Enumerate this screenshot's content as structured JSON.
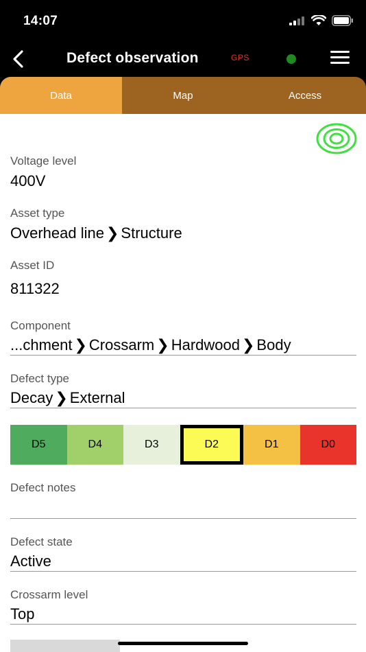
{
  "status_bar": {
    "time": "14:07"
  },
  "nav": {
    "title": "Defect observation",
    "gps_label": "GPS",
    "gps_status_color": "#1f8a1f"
  },
  "tabs": [
    {
      "label": "Data",
      "active": true
    },
    {
      "label": "Map",
      "active": false
    },
    {
      "label": "Access",
      "active": false
    }
  ],
  "fields": {
    "voltage_level": {
      "label": "Voltage level",
      "value": "400V"
    },
    "asset_type": {
      "label": "Asset type",
      "value_parts": [
        "Overhead line",
        "Structure"
      ]
    },
    "asset_id": {
      "label": "Asset ID",
      "value": "811322"
    },
    "component": {
      "label": "Component",
      "value_parts": [
        "...chment",
        "Crossarm",
        "Hardwood",
        "Body"
      ]
    },
    "defect_type": {
      "label": "Defect type",
      "value_parts": [
        "Decay",
        "External"
      ]
    },
    "defect_notes": {
      "label": "Defect notes",
      "value": ""
    },
    "defect_state": {
      "label": "Defect state",
      "value": "Active"
    },
    "crossarm_level": {
      "label": "Crossarm level",
      "value": "Top"
    }
  },
  "severity": {
    "selected": "D2",
    "options": [
      {
        "label": "D5",
        "color": "#4fab5d"
      },
      {
        "label": "D4",
        "color": "#a1d06a"
      },
      {
        "label": "D3",
        "color": "#e6f0da"
      },
      {
        "label": "D2",
        "color": "#fcfa55"
      },
      {
        "label": "D1",
        "color": "#f4c144"
      },
      {
        "label": "D0",
        "color": "#e8342a"
      }
    ]
  },
  "icons": {
    "back": "chevron-left-icon",
    "menu": "hamburger-menu-icon",
    "target": "location-target-icon",
    "separator": "chevron-right-icon"
  }
}
